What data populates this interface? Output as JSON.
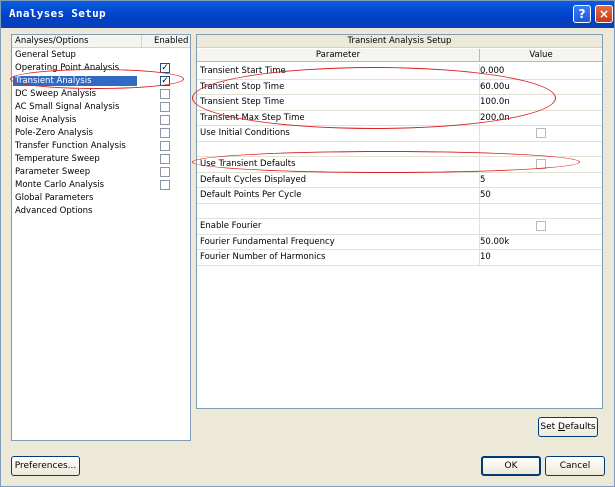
{
  "window": {
    "title": "Analyses Setup",
    "help_glyph": "?",
    "close_glyph": "×"
  },
  "left": {
    "col_name": "Analyses/Options",
    "col_enabled": "Enabled",
    "items": [
      {
        "label": "General Setup",
        "checkbox": "none",
        "selected": false
      },
      {
        "label": "Operating Point Analysis",
        "checkbox": "checked",
        "selected": false
      },
      {
        "label": "Transient Analysis",
        "checkbox": "checked",
        "selected": true
      },
      {
        "label": "DC Sweep Analysis",
        "checkbox": "unchecked",
        "selected": false
      },
      {
        "label": "AC Small Signal Analysis",
        "checkbox": "unchecked",
        "selected": false
      },
      {
        "label": "Noise Analysis",
        "checkbox": "unchecked",
        "selected": false
      },
      {
        "label": "Pole-Zero Analysis",
        "checkbox": "unchecked",
        "selected": false
      },
      {
        "label": "Transfer Function Analysis",
        "checkbox": "unchecked",
        "selected": false
      },
      {
        "label": "Temperature Sweep",
        "checkbox": "unchecked",
        "selected": false
      },
      {
        "label": "Parameter Sweep",
        "checkbox": "unchecked",
        "selected": false
      },
      {
        "label": "Monte Carlo Analysis",
        "checkbox": "unchecked",
        "selected": false
      },
      {
        "label": "Global Parameters",
        "checkbox": "none",
        "selected": false
      },
      {
        "label": "Advanced Options",
        "checkbox": "none",
        "selected": false
      }
    ],
    "check_glyph": "✓"
  },
  "right": {
    "title": "Transient Analysis Setup",
    "col_param": "Parameter",
    "col_value": "Value",
    "rows": [
      {
        "name": "Transient Start Time",
        "value": "0.000",
        "type": "text"
      },
      {
        "name": "Transient Stop Time",
        "value": "60.00u",
        "type": "text"
      },
      {
        "name": "Transient Step Time",
        "value": "100.0n",
        "type": "text"
      },
      {
        "name": "Transient Max Step Time",
        "value": "200.0n",
        "type": "text"
      },
      {
        "name": "Use Initial Conditions",
        "value": "",
        "type": "checkbox"
      },
      {
        "name": "",
        "value": "",
        "type": "blank"
      },
      {
        "name": "Use Transient Defaults",
        "value": "",
        "type": "checkbox"
      },
      {
        "name": "Default Cycles Displayed",
        "value": "5",
        "type": "text"
      },
      {
        "name": "Default Points Per Cycle",
        "value": "50",
        "type": "text"
      },
      {
        "name": "",
        "value": "",
        "type": "blank"
      },
      {
        "name": "Enable Fourier",
        "value": "",
        "type": "checkbox"
      },
      {
        "name": "Fourier Fundamental Frequency",
        "value": "50.00k",
        "type": "text"
      },
      {
        "name": "Fourier Number of Harmonics",
        "value": "10",
        "type": "text"
      }
    ]
  },
  "buttons": {
    "set_defaults_pre": "Set ",
    "set_defaults_ul": "D",
    "set_defaults_post": "efaults",
    "preferences": "Preferences...",
    "ok": "OK",
    "cancel": "Cancel"
  },
  "colors": {
    "selection": "#316ac5",
    "annotation": "#d91f1f",
    "titlebar": "#0040c8"
  }
}
